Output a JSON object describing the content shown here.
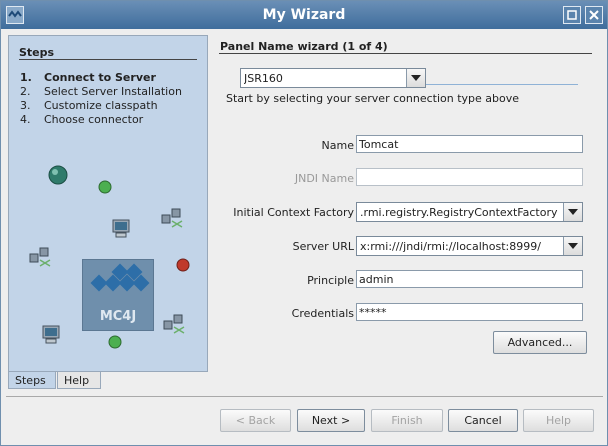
{
  "window": {
    "title": "My Wizard",
    "icon": "wizard-app-icon",
    "accent": "#4f7aa6"
  },
  "steps": {
    "title": "Steps",
    "items": [
      {
        "num": "1.",
        "label": "Connect to Server"
      },
      {
        "num": "2.",
        "label": "Select Server Installation"
      },
      {
        "num": "3.",
        "label": "Customize classpath"
      },
      {
        "num": "4.",
        "label": "Choose connector"
      }
    ],
    "logo_text": "MC4J"
  },
  "tabs": {
    "steps": "Steps",
    "help": "Help"
  },
  "panel": {
    "title": "Panel Name wizard (1 of 4)",
    "connection_type": "JSR160",
    "hint": "Start by selecting your server connection type above",
    "fields": {
      "name": {
        "label": "Name",
        "value": "Tomcat"
      },
      "jndi_name": {
        "label": "JNDI Name",
        "value": ""
      },
      "context_factory": {
        "label": "Initial Context Factory",
        "value": ".rmi.registry.RegistryContextFactory"
      },
      "server_url": {
        "label": "Server URL",
        "value": "x:rmi:///jndi/rmi://localhost:8999/"
      },
      "principle": {
        "label": "Principle",
        "value": "admin"
      },
      "credentials": {
        "label": "Credentials",
        "value": "*****"
      }
    },
    "advanced_label": "Advanced..."
  },
  "buttons": {
    "back": "< Back",
    "next": "Next >",
    "finish": "Finish",
    "cancel": "Cancel",
    "help": "Help"
  }
}
